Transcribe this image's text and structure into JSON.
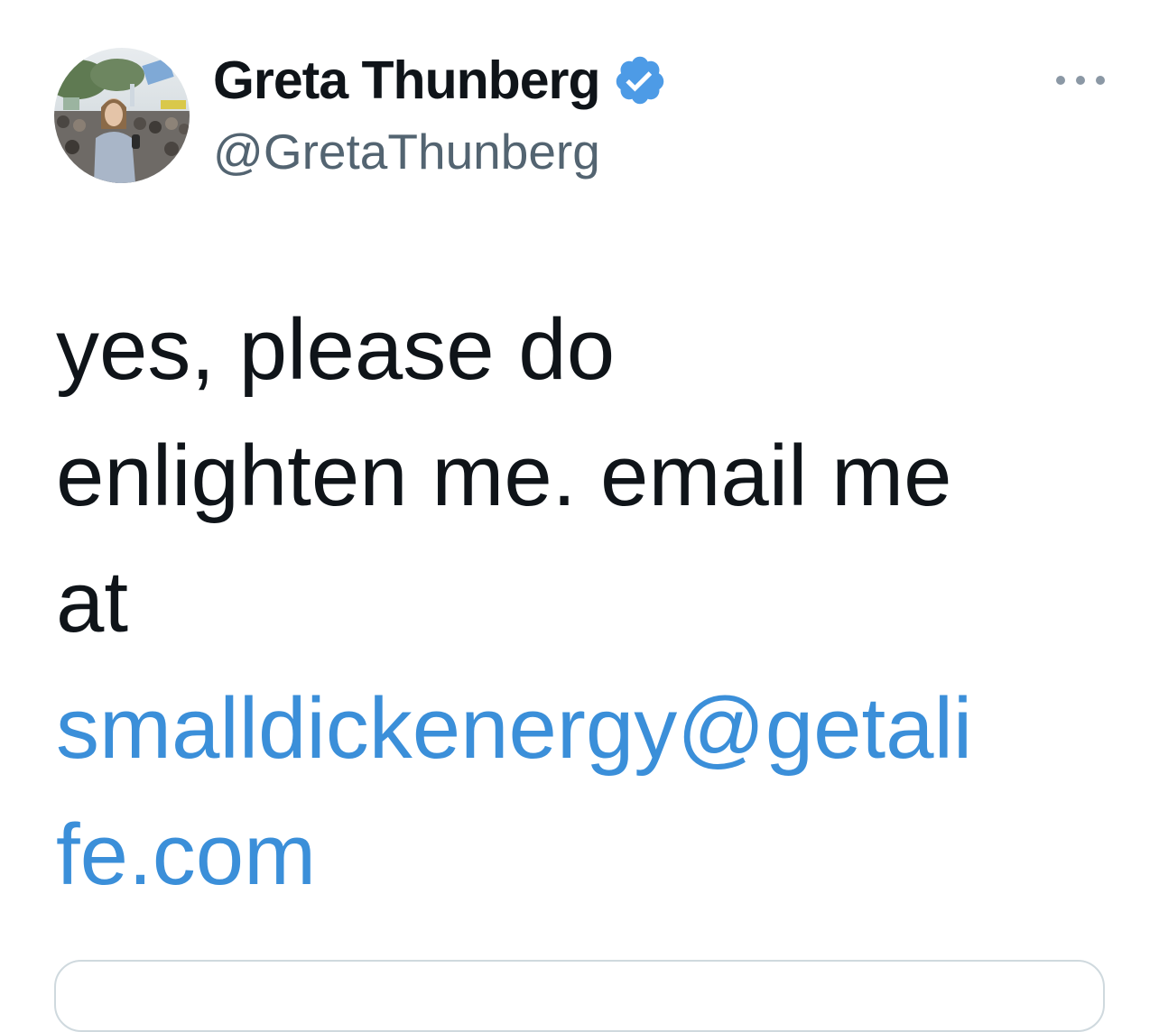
{
  "tweet": {
    "author": {
      "display_name": "Greta Thunberg",
      "handle": "@GretaThunberg",
      "verified": true,
      "avatar_icon": "profile-photo-icon"
    },
    "menu_icon": "more-options-icon",
    "text_lines": [
      "yes, please do",
      "enlighten me. email me",
      "at"
    ],
    "link_lines": [
      "smalldickenergy@getali",
      "fe.com"
    ]
  },
  "colors": {
    "text": "#0f1419",
    "secondary_text": "#536471",
    "link": "#3b8fd9",
    "verified_badge": "#4d9be6",
    "border": "#cfd9de"
  }
}
